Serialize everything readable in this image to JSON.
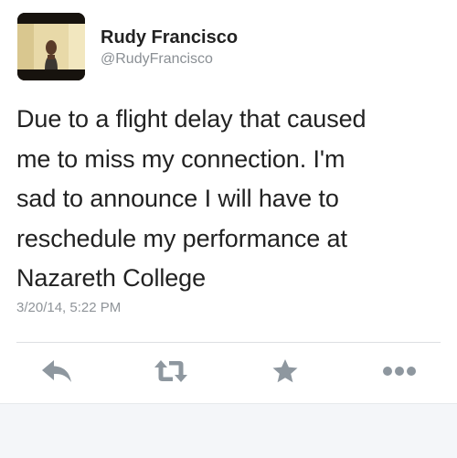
{
  "tweet": {
    "author": {
      "display_name": "Rudy Francisco",
      "handle": "@RudyFrancisco"
    },
    "text_lines": [
      "Due to a flight delay that caused",
      "me to miss my connection. I'm",
      "sad to announce I will have to",
      "reschedule my performance at",
      "Nazareth College"
    ],
    "timestamp": "3/20/14, 5:22 PM",
    "actions": {
      "reply_icon": "reply-icon",
      "retweet_icon": "retweet-icon",
      "favorite_icon": "star-icon",
      "more_icon": "more-dots-icon"
    },
    "colors": {
      "icon_gray": "#8e979f",
      "text": "#222222",
      "secondary_text": "#8a8f94"
    }
  }
}
